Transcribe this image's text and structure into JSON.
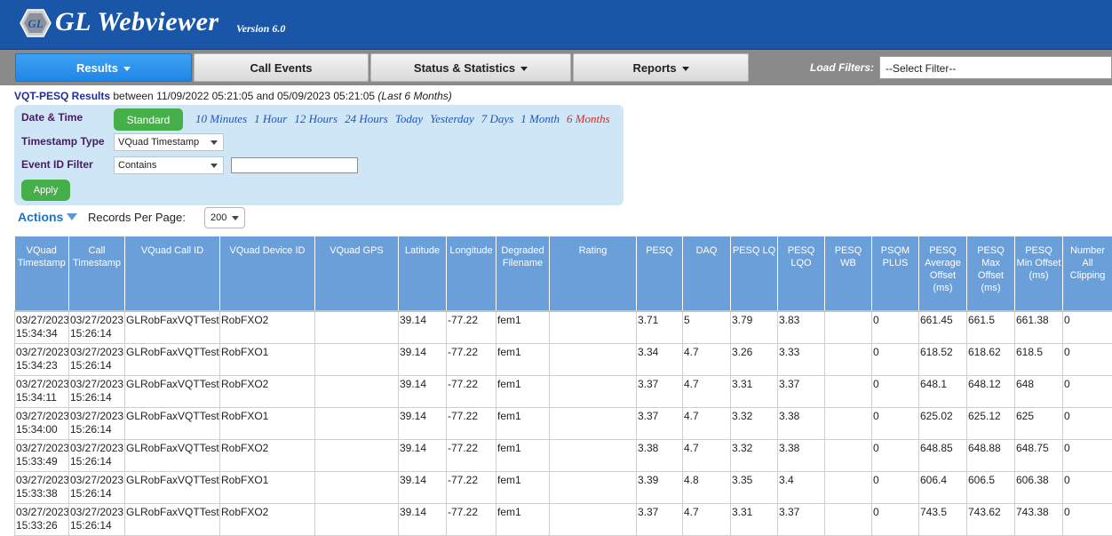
{
  "header": {
    "logo_text": "GL",
    "title": "GL Webviewer",
    "version": "Version 6.0"
  },
  "nav": {
    "items": [
      {
        "label": "Results",
        "has_caret": true,
        "active": true
      },
      {
        "label": "Call Events",
        "has_caret": false,
        "active": false
      },
      {
        "label": "Status & Statistics",
        "has_caret": true,
        "active": false
      },
      {
        "label": "Reports",
        "has_caret": true,
        "active": false
      }
    ],
    "load_filters_label": "Load Filters:",
    "filter_select_value": "--Select Filter--"
  },
  "results": {
    "title": "VQT-PESQ Results",
    "between_text": " between 11/09/2022 05:21:05 and 05/09/2023 05:21:05 ",
    "range_text": "(Last 6 Months)"
  },
  "filters": {
    "date_time_label": "Date & Time",
    "standard_button": "Standard",
    "ranges": [
      "10 Minutes",
      "1 Hour",
      "12 Hours",
      "24 Hours",
      "Today",
      "Yesterday",
      "7 Days",
      "1 Month",
      "6 Months"
    ],
    "active_range": "6 Months",
    "timestamp_type_label": "Timestamp Type",
    "timestamp_type_value": "VQuad Timestamp",
    "event_id_label": "Event ID Filter",
    "event_id_mode": "Contains",
    "event_id_value": "",
    "apply_button": "Apply"
  },
  "toolbar": {
    "actions_label": "Actions",
    "records_per_page_label": "Records Per Page:",
    "records_per_page_value": "200"
  },
  "table": {
    "columns": [
      "VQuad Timestamp",
      "Call Timestamp",
      "VQuad Call ID",
      "VQuad Device ID",
      "VQuad GPS",
      "Latitude",
      "Longitude",
      "Degraded Filename",
      "Rating",
      "PESQ",
      "DAQ",
      "PESQ LQ",
      "PESQ LQO",
      "PESQ WB",
      "PSQM PLUS",
      "PESQ Average Offset (ms)",
      "PESQ Max Offset (ms)",
      "PESQ Min Offset (ms)",
      "Number All Clipping"
    ],
    "rows": [
      [
        "03/27/2023|15:34:34",
        "03/27/2023|15:26:14",
        "GLRobFaxVQTTest",
        "RobFXO2",
        "",
        "39.14",
        "-77.22",
        "fem1",
        "",
        "3.71",
        "5",
        "3.79",
        "3.83",
        "",
        "0",
        "661.45",
        "661.5",
        "661.38",
        "0"
      ],
      [
        "03/27/2023|15:34:23",
        "03/27/2023|15:26:14",
        "GLRobFaxVQTTest",
        "RobFXO1",
        "",
        "39.14",
        "-77.22",
        "fem1",
        "",
        "3.34",
        "4.7",
        "3.26",
        "3.33",
        "",
        "0",
        "618.52",
        "618.62",
        "618.5",
        "0"
      ],
      [
        "03/27/2023|15:34:11",
        "03/27/2023|15:26:14",
        "GLRobFaxVQTTest",
        "RobFXO2",
        "",
        "39.14",
        "-77.22",
        "fem1",
        "",
        "3.37",
        "4.7",
        "3.31",
        "3.37",
        "",
        "0",
        "648.1",
        "648.12",
        "648",
        "0"
      ],
      [
        "03/27/2023|15:34:00",
        "03/27/2023|15:26:14",
        "GLRobFaxVQTTest",
        "RobFXO1",
        "",
        "39.14",
        "-77.22",
        "fem1",
        "",
        "3.37",
        "4.7",
        "3.32",
        "3.38",
        "",
        "0",
        "625.02",
        "625.12",
        "625",
        "0"
      ],
      [
        "03/27/2023|15:33:49",
        "03/27/2023|15:26:14",
        "GLRobFaxVQTTest",
        "RobFXO2",
        "",
        "39.14",
        "-77.22",
        "fem1",
        "",
        "3.38",
        "4.7",
        "3.32",
        "3.38",
        "",
        "0",
        "648.85",
        "648.88",
        "648.75",
        "0"
      ],
      [
        "03/27/2023|15:33:38",
        "03/27/2023|15:26:14",
        "GLRobFaxVQTTest",
        "RobFXO1",
        "",
        "39.14",
        "-77.22",
        "fem1",
        "",
        "3.39",
        "4.8",
        "3.35",
        "3.4",
        "",
        "0",
        "606.4",
        "606.5",
        "606.38",
        "0"
      ],
      [
        "03/27/2023|15:33:26",
        "03/27/2023|15:26:14",
        "GLRobFaxVQTTest",
        "RobFXO2",
        "",
        "39.14",
        "-77.22",
        "fem1",
        "",
        "3.37",
        "4.7",
        "3.31",
        "3.37",
        "",
        "0",
        "743.5",
        "743.62",
        "743.38",
        "0"
      ]
    ]
  },
  "colors": {
    "header_bg": "#1a56a8",
    "nav_bg": "#8a8a8a",
    "active_tab": "#2a93ec",
    "panel_bg": "#cfe6f7",
    "green_button": "#45b04a",
    "table_header_bg": "#6b9fd9",
    "link_blue": "#1d55c2",
    "active_link_red": "#d22b2b"
  },
  "icons": {
    "logo": "gl-hexagon-logo-icon",
    "dropdown": "chevron-down-icon",
    "actions": "triangle-down-icon"
  }
}
